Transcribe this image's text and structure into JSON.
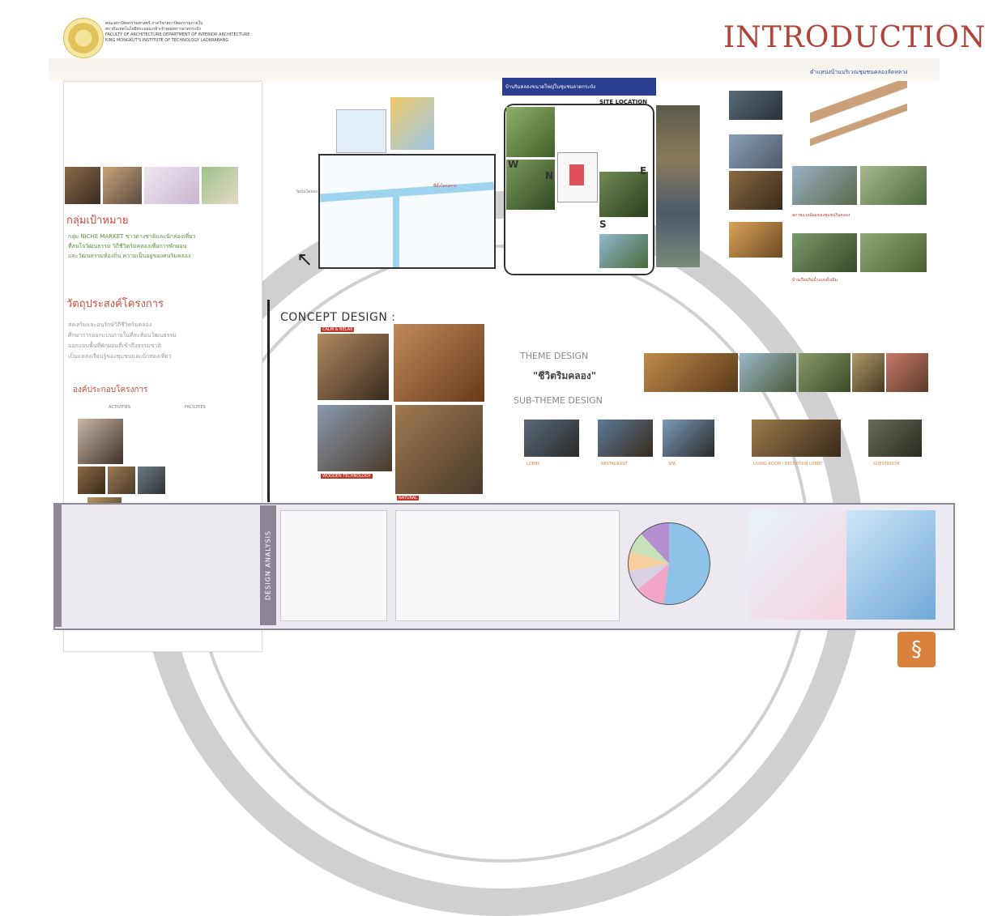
{
  "header": {
    "org_line1": "คณะสถาปัตยกรรมศาสตร์ ภาควิชาสถาปัตยกรรมภายใน",
    "org_line2": "สถาบันเทคโนโลยีพระจอมเกล้าเจ้าคุณทหารลาดกระบัง",
    "org_line3": "FACULTY OF ARCHITECTURE  DEPARTMENT OF INTERIOR ARCHITECTURE",
    "org_line4": "KING MONGKUT'S INSTITUTE OF TECHNOLOGY LADKRABANG",
    "title": "INTRODUCTION"
  },
  "left_panel": {
    "target_heading": "กลุ่มเป้าหมาย",
    "target_items": [
      "กลุ่ม NICHE MARKET ชาวต่างชาติและนักท่องเที่ยว",
      "ที่สนใจวัฒนธรรม วิถีชีวิตริมคลองเพื่อการพักผ่อน",
      "และวัฒนธรรมท้องถิ่น ความเป็นอยู่ของคนริมคลอง"
    ],
    "objective_heading": "วัตถุประสงค์โครงการ",
    "objective_items": [
      "ส่งเสริมและอนุรักษ์วิถีชีวิตริมคลอง",
      "ศึกษาการออกแบบภายในที่สะท้อนวัฒนธรรม",
      "ออกแบบพื้นที่พักผ่อนที่เข้าถึงธรรมชาติ",
      "เป็นแหล่งเรียนรู้ของชุมชนและนักท่องเที่ยว"
    ],
    "components_heading": "องค์ประกอบโครงการ",
    "activities_label": "ACTIVITIES",
    "facilities_label": "FACILITIES"
  },
  "map": {
    "label_temple": "วัดบันไดทอง",
    "label_site": "ที่ตั้งโครงการ"
  },
  "site": {
    "banner": "บ้านริมคลองขนาดใหญ่ในชุมชนลาดกระบัง",
    "title": "SITE LOCATION",
    "compass": [
      "N",
      "E",
      "S",
      "W"
    ]
  },
  "right_column": {
    "heading": "ตำแหน่งบ้านบริเวณชุมชนคลองลัดหลวง",
    "caption1": "สภาพแวดล้อมของชุมชนริมคลอง",
    "caption2": "บ้านเรือนริมน้ำแบบดั้งเดิม"
  },
  "concept": {
    "heading": "CONCEPT DESIGN :",
    "photo_tags": [
      "CALM & RELAX",
      "WOODEN TECHNOLOGY",
      "NATURAL"
    ],
    "theme_label": "THEME DESIGN",
    "theme_value": "\"ชีวิตริมคลอง\"",
    "sub_theme_label": "SUB-THEME DESIGN",
    "sub_theme_captions": [
      "LOBBY",
      "RESTAURANT",
      "SPA",
      "LIVING ROOM / RECEPTION LOBBY",
      "GUESTROOM"
    ]
  },
  "analysis": {
    "tab_label": "DESIGN ANALYSIS"
  },
  "colors": {
    "title": "#b0433a",
    "accent_green": "#5a8f3a",
    "analysis_band": "#8f8896"
  }
}
